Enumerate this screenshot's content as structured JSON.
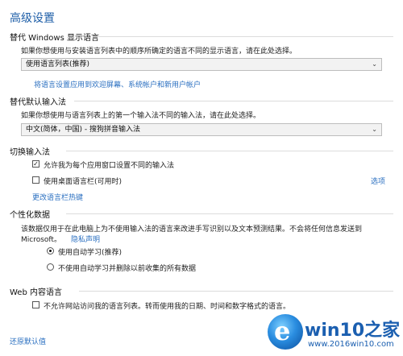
{
  "title": "高级设置",
  "override_display_language": {
    "heading": "替代 Windows 显示语言",
    "description": "如果你想使用与安装语言列表中的顺序所确定的语言不同的显示语言，请在此处选择。",
    "selected": "使用语言列表(推荐)",
    "apply_link": "将语言设置应用到欢迎屏幕、系统帐户和新用户帐户"
  },
  "override_input_method": {
    "heading": "替代默认输入法",
    "description": "如果你想使用与语言列表上的第一个输入法不同的输入法，请在此处选择。",
    "selected": "中文(简体，中国) - 搜狗拼音输入法"
  },
  "switch_input": {
    "heading": "切换输入法",
    "option1": "允许我为每个应用窗口设置不同的输入法",
    "option1_checked": "✓",
    "option2": "使用桌面语言栏(可用时)",
    "options_link": "选项",
    "hotkeys_link": "更改语言栏热键"
  },
  "personalization": {
    "heading": "个性化数据",
    "description_line1": "该数据仅用于在此电脑上为不使用输入法的语言来改进手写识别以及文本预测结果。不会将任何信息发送到",
    "description_line2": "Microsoft。",
    "privacy_link": "隐私声明",
    "radio1": "使用自动学习(推荐)",
    "radio2": "不使用自动学习并删除以前收集的所有数据"
  },
  "web_language": {
    "heading": "Web 内容语言",
    "option": "不允许网站访问我的语言列表。转而使用我的日期、时间和数字格式的语言。"
  },
  "restore_link": "还原默认值",
  "watermark": {
    "brand": "win10之家",
    "site": "www.2016win10.com"
  }
}
